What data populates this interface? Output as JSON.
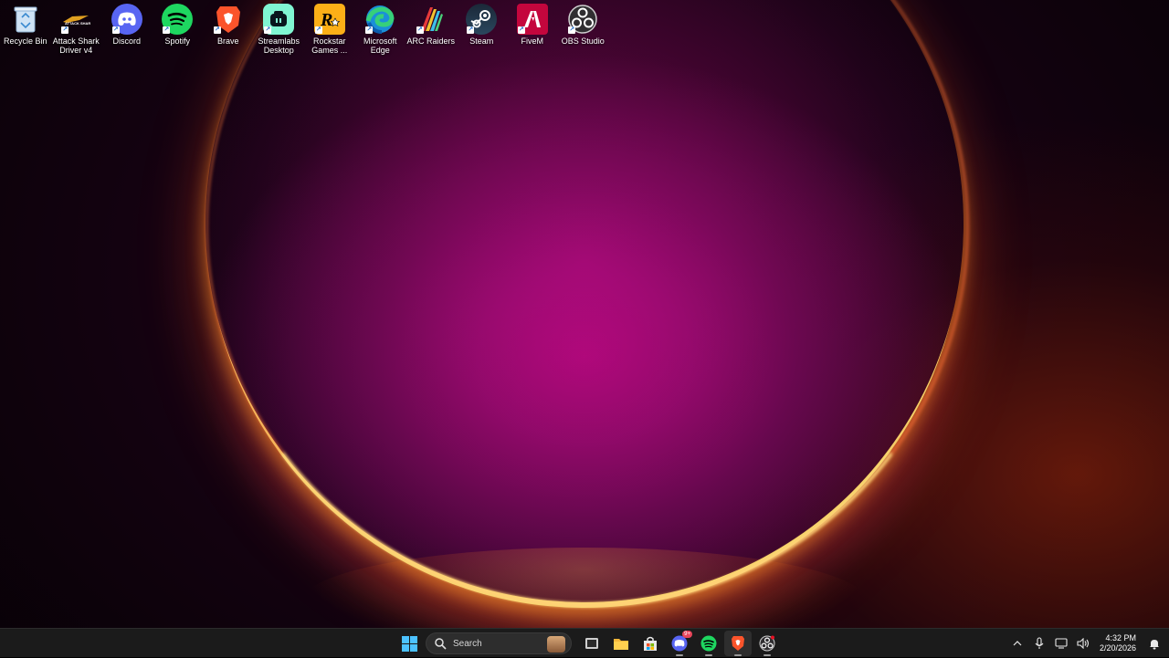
{
  "desktop": {
    "icons": [
      {
        "label": "Recycle Bin",
        "icon": "recycle-bin-icon"
      },
      {
        "label": "Attack Shark\nDriver v4",
        "icon": "attack-shark-icon"
      },
      {
        "label": "Discord",
        "icon": "discord-icon"
      },
      {
        "label": "Spotify",
        "icon": "spotify-icon"
      },
      {
        "label": "Brave",
        "icon": "brave-icon"
      },
      {
        "label": "Streamlabs\nDesktop",
        "icon": "streamlabs-icon"
      },
      {
        "label": "Rockstar\nGames ...",
        "icon": "rockstar-icon"
      },
      {
        "label": "Microsoft\nEdge",
        "icon": "edge-icon"
      },
      {
        "label": "ARC Raiders",
        "icon": "arc-raiders-icon"
      },
      {
        "label": "Steam",
        "icon": "steam-icon"
      },
      {
        "label": "FiveM",
        "icon": "fivem-icon"
      },
      {
        "label": "OBS Studio",
        "icon": "obs-icon"
      }
    ]
  },
  "taskbar": {
    "search_placeholder": "Search",
    "discord_badge": "9+",
    "pinned": [
      "start-icon",
      "task-view-icon",
      "file-explorer-icon",
      "microsoft-store-icon",
      "discord-icon",
      "spotify-icon",
      "brave-icon",
      "obs-icon"
    ],
    "tray": {
      "time": "4:32 PM",
      "date": "2/20/2026"
    }
  },
  "colors": {
    "taskbar_bg": "#1b1b1b",
    "discord": "#5865f2",
    "spotify": "#1ed760",
    "brave": "#fb542b",
    "streamlabs": "#80f5d2",
    "rockstar": "#fcaf17",
    "fivem": "#c4063d"
  }
}
